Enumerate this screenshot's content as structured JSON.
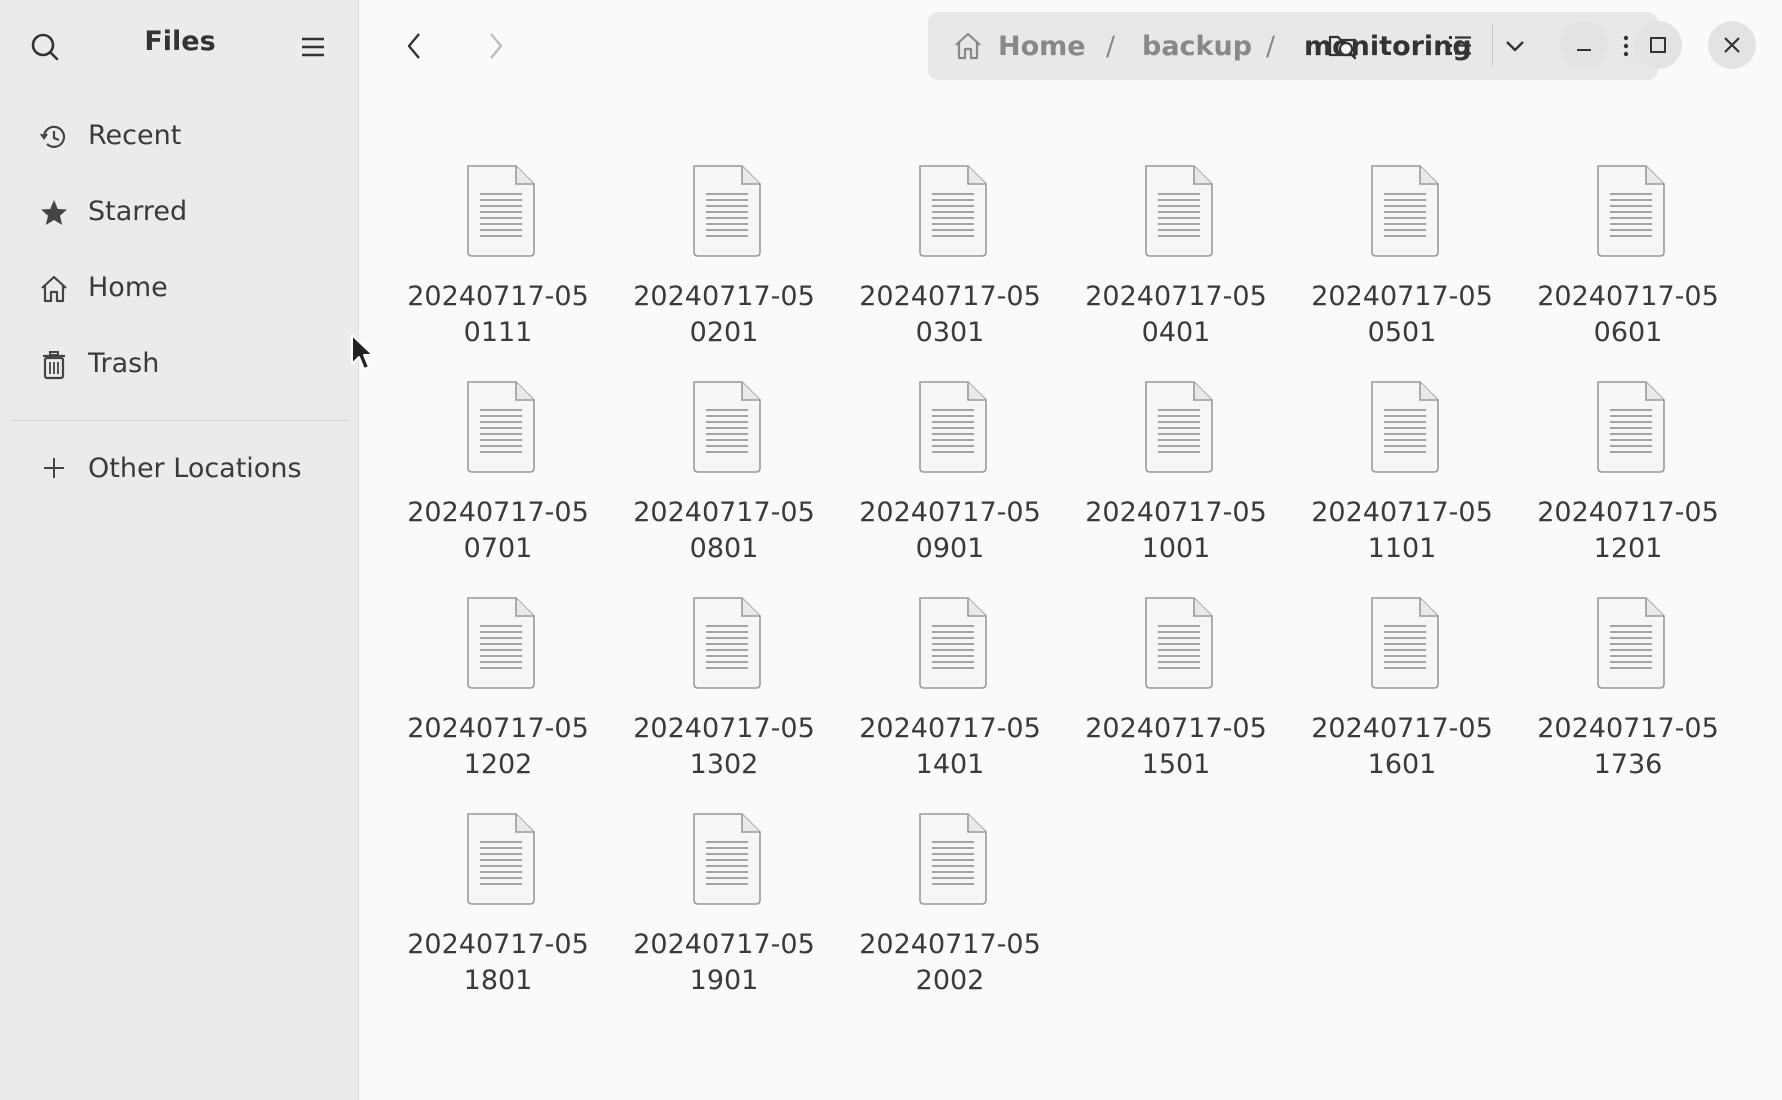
{
  "app": {
    "title": "Files"
  },
  "sidebar": {
    "items": [
      {
        "label": "Recent",
        "icon": "clock-history-icon"
      },
      {
        "label": "Starred",
        "icon": "star-icon"
      },
      {
        "label": "Home",
        "icon": "home-icon"
      },
      {
        "label": "Trash",
        "icon": "trash-icon"
      }
    ],
    "other_locations": {
      "label": "Other Locations",
      "icon": "plus-icon"
    }
  },
  "pathbar": {
    "segments": [
      "Home",
      "backup",
      "monitoring"
    ],
    "separator": "/"
  },
  "files": [
    {
      "line1": "20240717-05",
      "line2": "0111"
    },
    {
      "line1": "20240717-05",
      "line2": "0201"
    },
    {
      "line1": "20240717-05",
      "line2": "0301"
    },
    {
      "line1": "20240717-05",
      "line2": "0401"
    },
    {
      "line1": "20240717-05",
      "line2": "0501"
    },
    {
      "line1": "20240717-05",
      "line2": "0601"
    },
    {
      "line1": "20240717-05",
      "line2": "0701"
    },
    {
      "line1": "20240717-05",
      "line2": "0801"
    },
    {
      "line1": "20240717-05",
      "line2": "0901"
    },
    {
      "line1": "20240717-05",
      "line2": "1001"
    },
    {
      "line1": "20240717-05",
      "line2": "1101"
    },
    {
      "line1": "20240717-05",
      "line2": "1201"
    },
    {
      "line1": "20240717-05",
      "line2": "1202"
    },
    {
      "line1": "20240717-05",
      "line2": "1302"
    },
    {
      "line1": "20240717-05",
      "line2": "1401"
    },
    {
      "line1": "20240717-05",
      "line2": "1501"
    },
    {
      "line1": "20240717-05",
      "line2": "1601"
    },
    {
      "line1": "20240717-05",
      "line2": "1736"
    },
    {
      "line1": "20240717-05",
      "line2": "1801"
    },
    {
      "line1": "20240717-05",
      "line2": "1901"
    },
    {
      "line1": "20240717-05",
      "line2": "2002"
    }
  ],
  "colors": {
    "sidebar_bg": "#ebebeb",
    "content_bg": "#fafafa",
    "pathbar_bg": "#e8e8e8",
    "text": "#3a3a3a",
    "muted_text": "#888888"
  }
}
